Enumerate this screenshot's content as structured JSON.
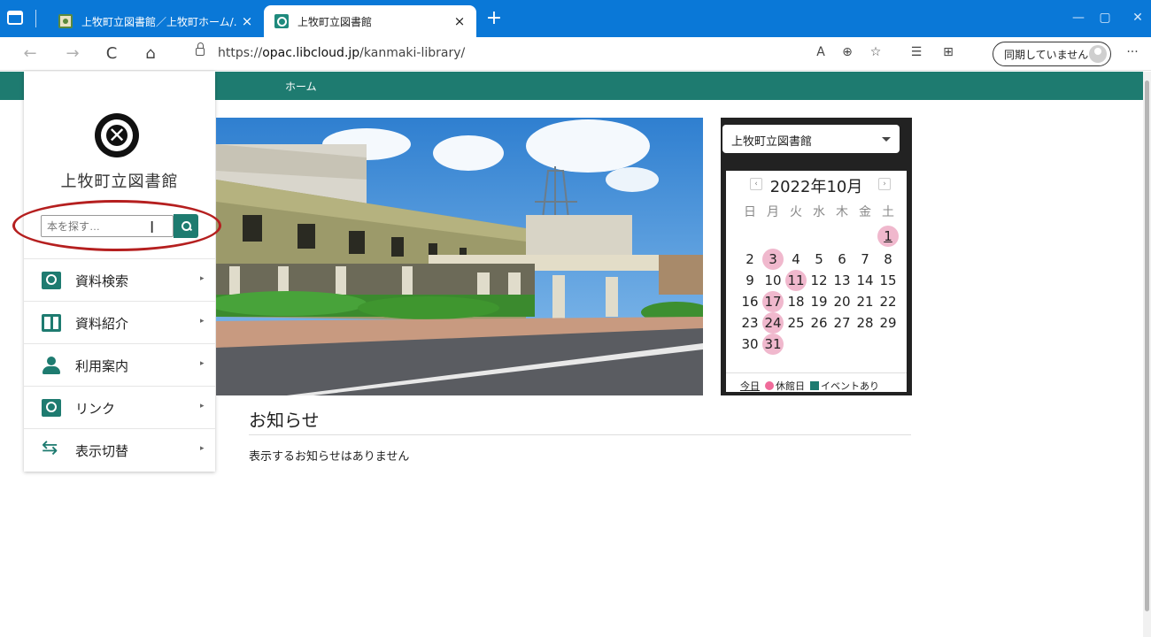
{
  "browser": {
    "tabs": [
      {
        "title": "上牧町立図書館／上牧町ホーム/…",
        "active": false
      },
      {
        "title": "上牧町立図書館",
        "active": true
      }
    ],
    "new_tab": "+",
    "tab_close": "×",
    "window": {
      "minimize": "—",
      "restore": "▢",
      "close": "✕"
    },
    "nav": {
      "back": "←",
      "forward": "→",
      "reload": "C",
      "home": "⌂"
    },
    "url_prefix": "https://",
    "url_host": "opac.libcloud.jp",
    "url_path": "/kanmaki-library/",
    "toolbar_icons": {
      "read_aloud": "A",
      "zoom": "⊕",
      "favorite": "☆",
      "favorites": "☰",
      "collections": "⊞",
      "more": "···"
    },
    "sync_label": "同期していません"
  },
  "site": {
    "nav_home": "ホーム",
    "library_name": "上牧町立図書館",
    "search_placeholder": "本を探す…",
    "menu": [
      {
        "label": "資料検索",
        "icon": "search-book-icon"
      },
      {
        "label": "資料紹介",
        "icon": "open-book-icon"
      },
      {
        "label": "利用案内",
        "icon": "user-guide-icon"
      },
      {
        "label": "リンク",
        "icon": "link-icon"
      },
      {
        "label": "表示切替",
        "icon": "switch-arrows-icon"
      }
    ],
    "menu_arrow": "▸"
  },
  "calendar": {
    "library_select": "上牧町立図書館",
    "month_title": "2022年10月",
    "prev": "‹",
    "next": "›",
    "weekdays": [
      "日",
      "月",
      "火",
      "水",
      "木",
      "金",
      "土"
    ],
    "first_weekday_index": 6,
    "days_in_month": 31,
    "today": 1,
    "closed_days": [
      1,
      3,
      11,
      17,
      24,
      31
    ],
    "legend": {
      "today": "今日",
      "closed": "休館日",
      "event": "イベントあり"
    },
    "colors": {
      "closed": "#f0b8cd",
      "event": "#1e7b70"
    }
  },
  "news": {
    "title": "お知らせ",
    "empty_message": "表示するお知らせはありません"
  },
  "colors": {
    "browser_accent": "#0a78d7",
    "site_accent": "#1e7b70",
    "highlight": "#b51f1f"
  }
}
